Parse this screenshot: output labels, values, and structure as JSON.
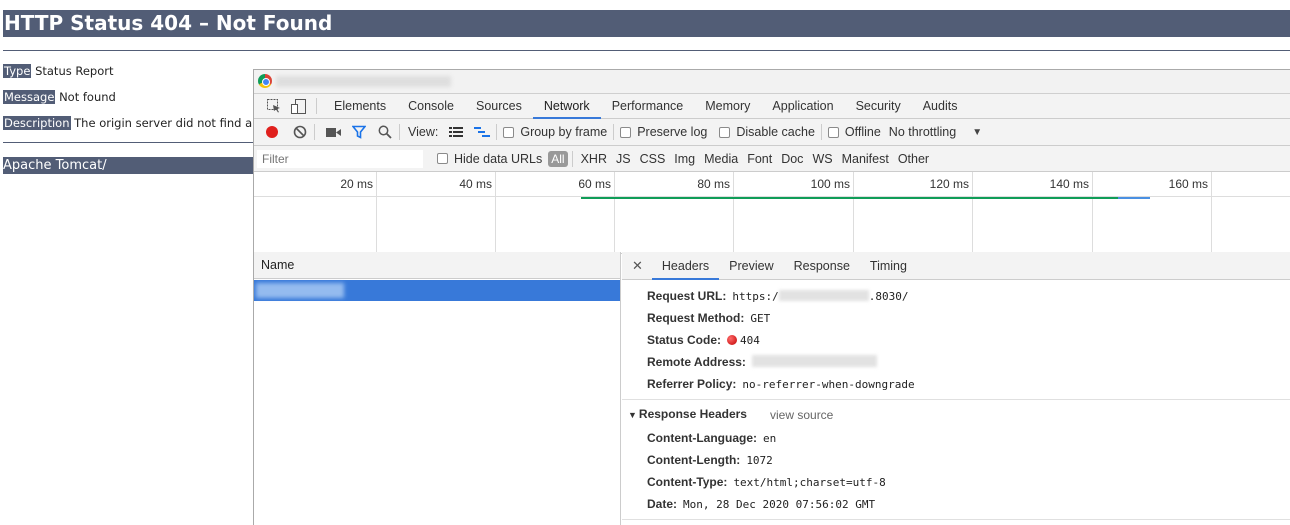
{
  "tomcat": {
    "title": "HTTP Status 404 – Not Found",
    "type_key": "Type",
    "type_val": "Status Report",
    "message_key": "Message",
    "message_val": "Not found",
    "description_key": "Description",
    "description_val": "The origin server did not find a c",
    "footer": "Apache Tomcat/"
  },
  "devtools": {
    "tabs": [
      "Elements",
      "Console",
      "Sources",
      "Network",
      "Performance",
      "Memory",
      "Application",
      "Security",
      "Audits"
    ],
    "active_tab": "Network",
    "toolbar": {
      "view_label": "View:",
      "group_by_frame": "Group by frame",
      "preserve_log": "Preserve log",
      "disable_cache": "Disable cache",
      "offline": "Offline",
      "throttling": "No throttling"
    },
    "filter": {
      "placeholder": "Filter",
      "hide_data_urls": "Hide data URLs",
      "types": [
        "All",
        "XHR",
        "JS",
        "CSS",
        "Img",
        "Media",
        "Font",
        "Doc",
        "WS",
        "Manifest",
        "Other"
      ]
    },
    "timeline": {
      "labels": [
        "20 ms",
        "40 ms",
        "60 ms",
        "80 ms",
        "100 ms",
        "120 ms",
        "140 ms",
        "160 ms"
      ],
      "colors": {
        "waiting": "#0f9d58",
        "download": "#4a90e2"
      }
    },
    "name_column": "Name",
    "detail_tabs": [
      "Headers",
      "Preview",
      "Response",
      "Timing"
    ],
    "general": {
      "request_url_label": "Request URL:",
      "request_url_value_prefix": "https:/",
      "request_url_value_suffix": ".8030/",
      "request_method_label": "Request Method:",
      "request_method_value": "GET",
      "status_code_label": "Status Code:",
      "status_code_value": "404",
      "remote_address_label": "Remote Address:",
      "referrer_policy_label": "Referrer Policy:",
      "referrer_policy_value": "no-referrer-when-downgrade"
    },
    "response_headers": {
      "title": "Response Headers",
      "view_source": "view source",
      "content_language_label": "Content-Language:",
      "content_language_value": "en",
      "content_length_label": "Content-Length:",
      "content_length_value": "1072",
      "content_type_label": "Content-Type:",
      "content_type_value": "text/html;charset=utf-8",
      "date_label": "Date:",
      "date_value": "Mon, 28 Dec 2020 07:56:02 GMT"
    }
  }
}
